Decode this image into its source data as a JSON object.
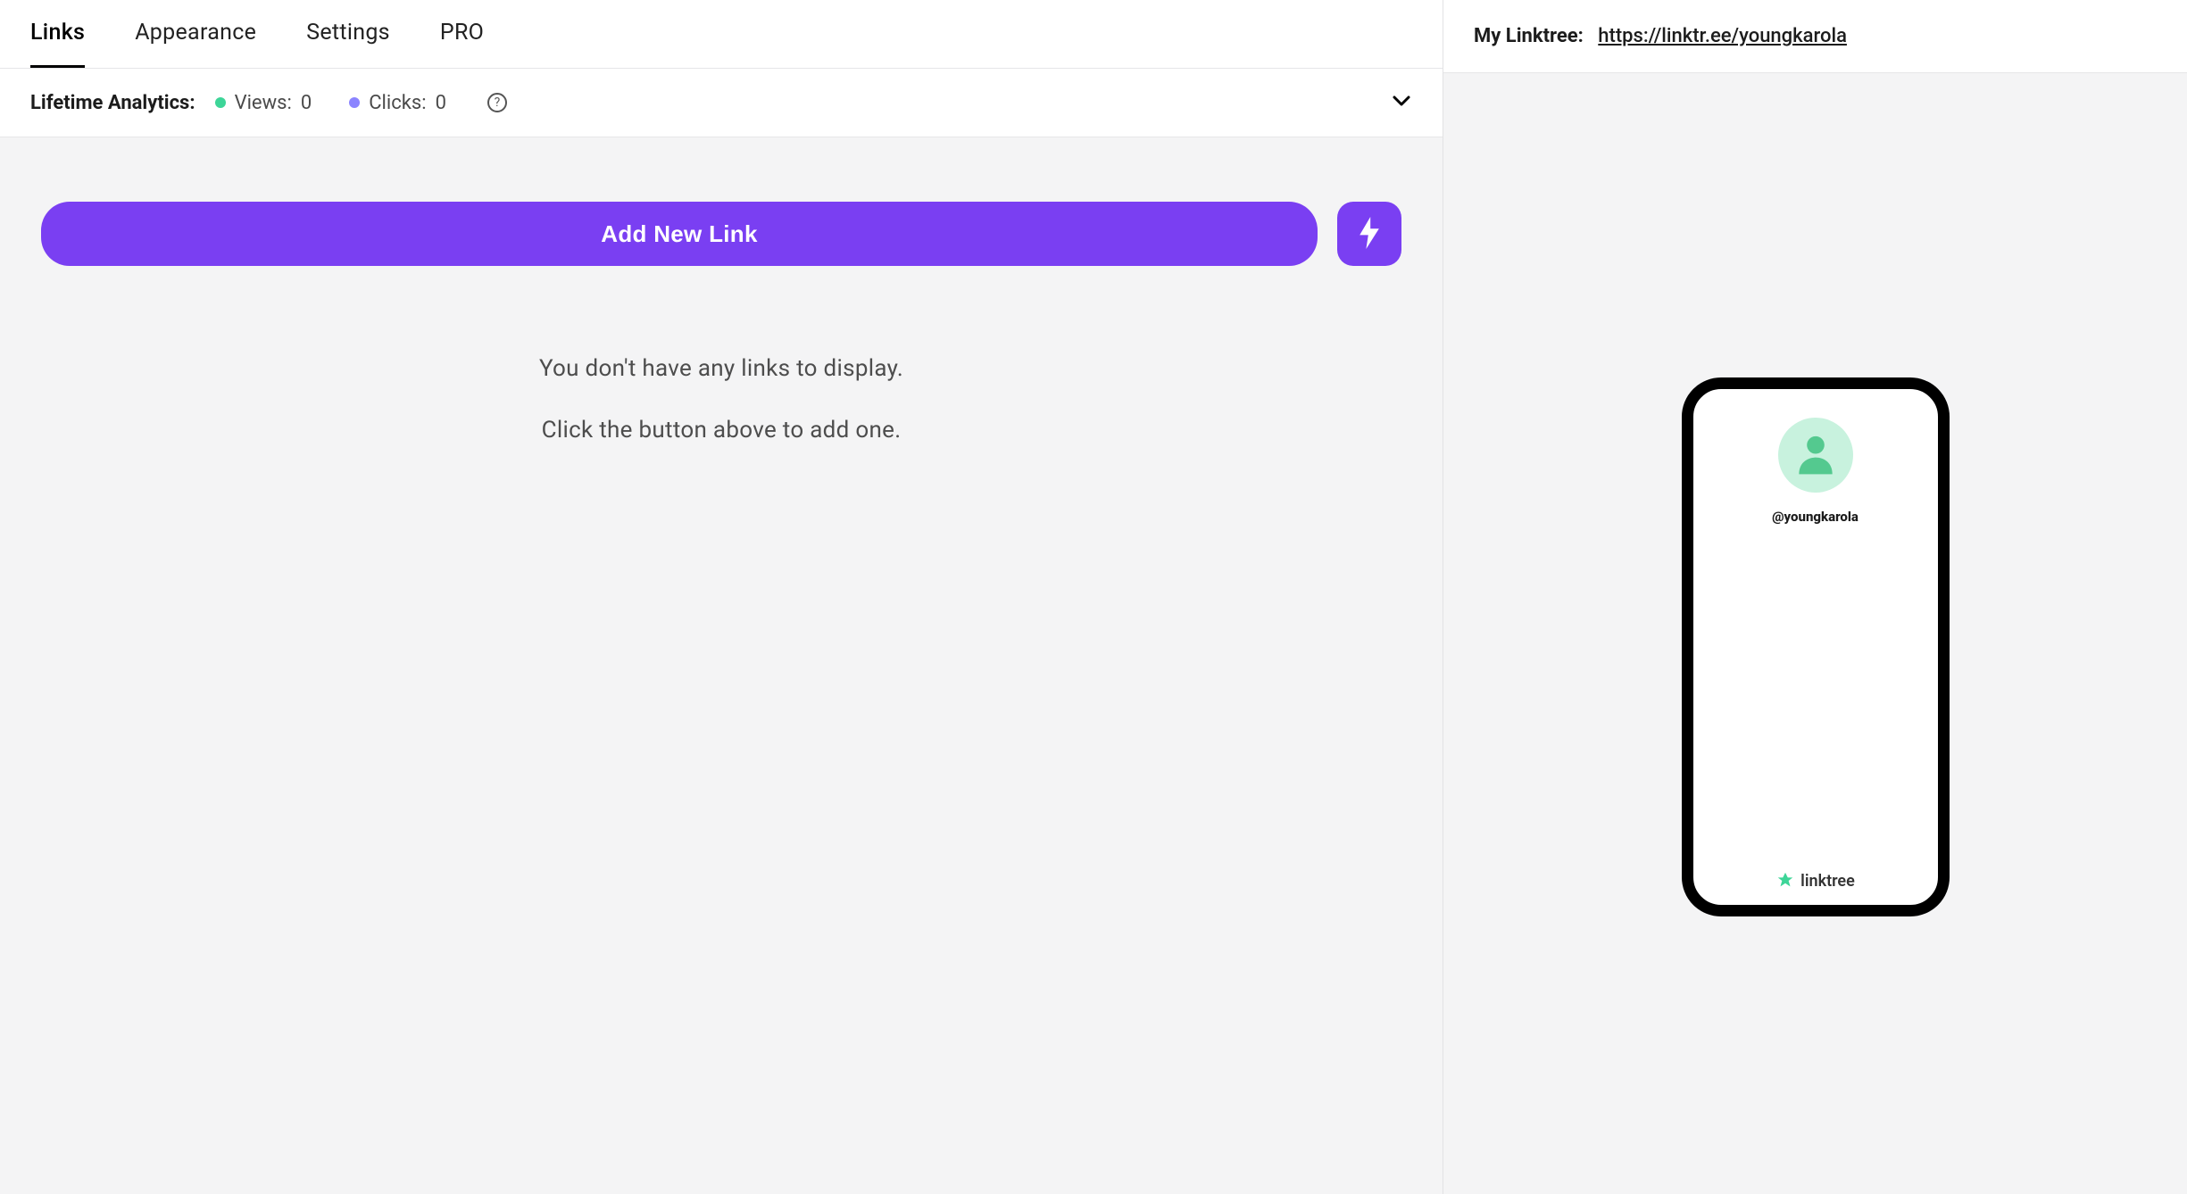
{
  "tabs": {
    "links": "Links",
    "appearance": "Appearance",
    "settings": "Settings",
    "pro": "PRO"
  },
  "analytics": {
    "label": "Lifetime Analytics:",
    "views_label": "Views:",
    "views_value": "0",
    "clicks_label": "Clicks:",
    "clicks_value": "0"
  },
  "actions": {
    "add_new_link": "Add New Link"
  },
  "empty_state": {
    "line1": "You don't have any links to display.",
    "line2": "Click the button above to add one."
  },
  "linktree": {
    "label": "My Linktree:",
    "url": "https://linktr.ee/youngkarola"
  },
  "preview": {
    "handle": "@youngkarola",
    "brand": "linktree"
  },
  "colors": {
    "accent": "#7a3ff2",
    "views_dot": "#3dd598",
    "clicks_dot": "#8b84ff",
    "avatar_bg": "#c8f2de",
    "avatar_fg": "#54c98f"
  }
}
